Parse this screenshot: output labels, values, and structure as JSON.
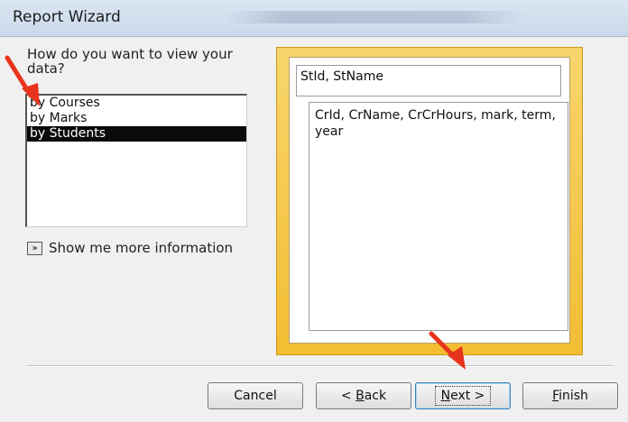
{
  "window": {
    "title": "Report Wizard"
  },
  "prompt": {
    "question": "How do you want to view your data?"
  },
  "view_options": {
    "items": [
      {
        "label": "by Courses",
        "selected": false
      },
      {
        "label": "by Marks",
        "selected": false
      },
      {
        "label": "by Students",
        "selected": true
      }
    ]
  },
  "more_info": {
    "label": "Show me more information",
    "icon": "double-chevron-right-icon"
  },
  "preview": {
    "group_fields": "StId, StName",
    "detail_fields": "CrId, CrName, CrCrHours, mark, term, year"
  },
  "buttons": {
    "cancel": {
      "label": "Cancel"
    },
    "back": {
      "pre": "< ",
      "accel": "B",
      "post": "ack"
    },
    "next": {
      "accel": "N",
      "post": "ext >"
    },
    "finish": {
      "accel": "F",
      "post": "inish"
    }
  },
  "annotations": {
    "arrow_color": "#e8341c"
  },
  "colors": {
    "preview_frame": "#f2bd32",
    "selected_row": "#0a0a0a"
  }
}
